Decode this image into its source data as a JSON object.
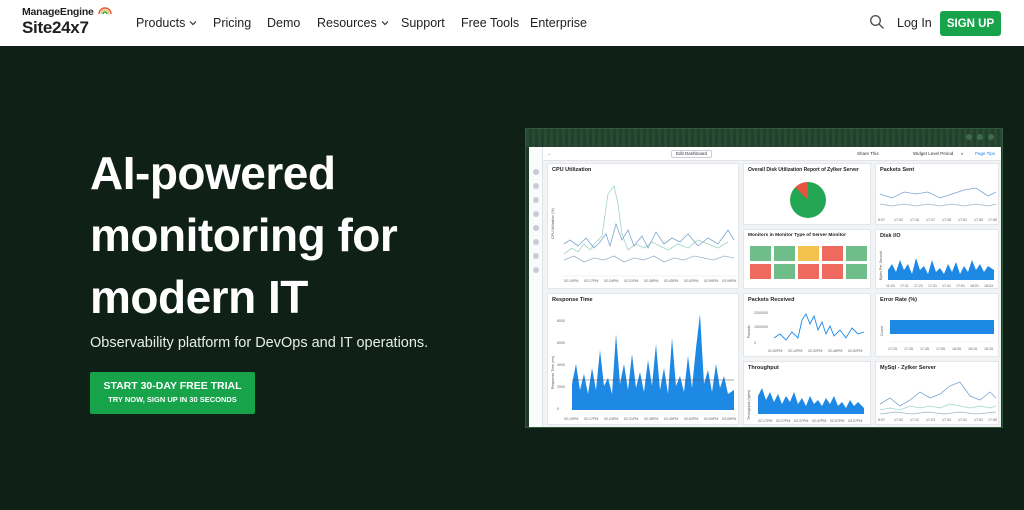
{
  "nav": {
    "logo_top": "ManageEngine",
    "logo_main": "Site24x7",
    "items": [
      {
        "label": "Products",
        "dropdown": true
      },
      {
        "label": "Pricing",
        "dropdown": false
      },
      {
        "label": "Demo",
        "dropdown": false
      },
      {
        "label": "Resources",
        "dropdown": true
      },
      {
        "label": "Support",
        "dropdown": false
      },
      {
        "label": "Free Tools",
        "dropdown": false
      },
      {
        "label": "Enterprise",
        "dropdown": false
      }
    ],
    "login": "Log In",
    "signup": "SIGN UP"
  },
  "hero": {
    "title_lines": [
      "AI-powered",
      "monitoring for",
      "modern IT"
    ],
    "subtitle": "Observability platform for DevOps and IT operations.",
    "cta_main": "START 30-DAY FREE TRIAL",
    "cta_sub": "TRY NOW, SIGN UP IN 30 SECONDS"
  },
  "dashboard": {
    "toolbar": {
      "edit": "Edit Dashboard",
      "share": "Share This",
      "period": "Widget Level Period",
      "page_tips": "Page Tips"
    },
    "widgets": {
      "cpu": {
        "title": "CPU Utilization",
        "ylabel": "CPU Utilization (%)",
        "x": [
          "02:10PM",
          "02:17PM",
          "02:24PM",
          "02:31PM",
          "02:38PM",
          "02:45PM",
          "02:52PM",
          "02:59PM",
          "03:06PM"
        ]
      },
      "disk_report": {
        "title": "Overall Disk Utilization Report of Zylker Server"
      },
      "monitors": {
        "title": "Monitors in Monitor Type of Server Monitor"
      },
      "packets_sent": {
        "title": "Packets Sent",
        "x": [
          "8:07",
          "17:02",
          "17:16",
          "17:27",
          "17:38",
          "17:51",
          "17:55",
          "17:58"
        ]
      },
      "disk_io": {
        "title": "Disk I/O",
        "ylabel": "Bytes Per Second",
        "x": [
          "11:03",
          "17:11",
          "17:21",
          "17:31",
          "17:41",
          "17:51",
          "18:01",
          "18:03"
        ]
      },
      "response_time": {
        "title": "Response Time",
        "ylabel": "Response Time (ms)",
        "y": [
          "8000",
          "6000",
          "4000",
          "2000",
          "0"
        ],
        "x": [
          "02:10PM",
          "02:17PM",
          "02:24PM",
          "02:31PM",
          "02:38PM",
          "02:45PM",
          "02:52PM",
          "02:59PM",
          "03:06PM"
        ]
      },
      "packets_received": {
        "title": "Packets Received",
        "ylabel": "Packets",
        "y": [
          "2000000",
          "1000000",
          "0"
        ],
        "x": [
          "01:52PM",
          "02:12PM",
          "02:32PM",
          "02:46PM",
          "02:52PM"
        ]
      },
      "error_rate": {
        "title": "Error Rate (%)",
        "ylabel": "Count",
        "x": [
          "17:25",
          "17:35",
          "17:45",
          "17:55",
          "18:05",
          "18:15",
          "18:25"
        ]
      },
      "throughput": {
        "title": "Throughput",
        "ylabel": "Throughput (bytes)",
        "x": [
          "02:17PM",
          "02:27PM",
          "02:37PM",
          "02:47PM",
          "02:57PM",
          "03:07PM"
        ]
      },
      "mysql": {
        "title": "MySql - Zylker Server",
        "x": [
          "8:07",
          "17:02",
          "17:12",
          "17:23",
          "17:33",
          "17:41",
          "17:51",
          "17:58"
        ]
      }
    },
    "colors": {
      "accent": "#16a34a",
      "chart_blue": "#1e88e5",
      "status_green": "#6fbe8a",
      "status_red": "#ee6a5f",
      "status_yellow": "#f2c14e"
    },
    "monitor_grid": [
      [
        "green",
        "green",
        "yellow",
        "red",
        "green"
      ],
      [
        "red",
        "green",
        "red",
        "red",
        "green"
      ]
    ],
    "pie_slices": [
      {
        "label": "used",
        "value": 0.88,
        "color": "#22a653"
      },
      {
        "label": "free",
        "value": 0.12,
        "color": "#e8533e"
      }
    ]
  }
}
